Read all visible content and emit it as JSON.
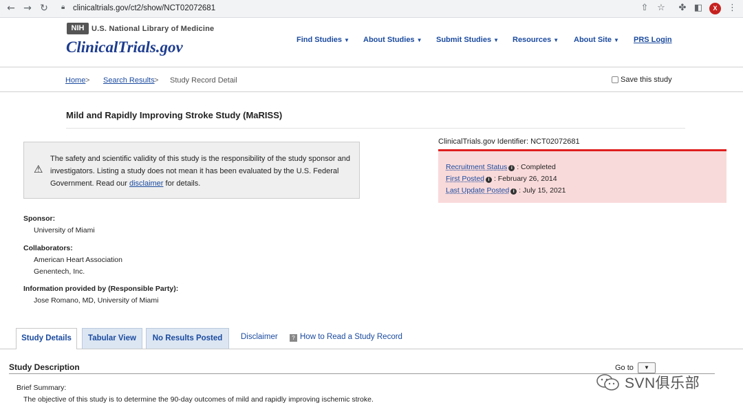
{
  "browser": {
    "url": "clinicaltrials.gov/ct2/show/NCT02072681",
    "avatar_letter": "X"
  },
  "header": {
    "nih_logo": "NIH",
    "nlm_text": "U.S. National Library of Medicine",
    "site_logo": "ClinicalTrials.gov",
    "nav": [
      {
        "label": "Find Studies"
      },
      {
        "label": "About Studies"
      },
      {
        "label": "Submit Studies"
      },
      {
        "label": "Resources"
      },
      {
        "label": "About Site"
      },
      {
        "label": "PRS Login"
      }
    ]
  },
  "breadcrumb": {
    "home": "Home",
    "search_results": "Search Results",
    "current": "Study Record Detail",
    "separator": ">",
    "save_label": "Save this study"
  },
  "study": {
    "title": "Mild and Rapidly Improving Stroke Study (MaRISS)",
    "identifier": "ClinicalTrials.gov Identifier: NCT02072681"
  },
  "disclaimer": {
    "text_before": "The safety and scientific validity of this study is the responsibility of the study sponsor and investigators. Listing a study does not mean it has been evaluated by the U.S. Federal Government. Read our ",
    "link": "disclaimer",
    "text_after": " for details."
  },
  "status": {
    "recruitment_label": "Recruitment Status",
    "recruitment_value": ": Completed",
    "first_posted_label": "First Posted",
    "first_posted_value": ": February 26, 2014",
    "last_update_label": "Last Update Posted",
    "last_update_value": ": July 15, 2021"
  },
  "sponsor": {
    "sponsor_heading": "Sponsor:",
    "sponsor_value": "University of Miami",
    "collaborators_heading": "Collaborators:",
    "collaborators": [
      "American Heart Association",
      "Genentech, Inc."
    ],
    "info_heading": "Information provided by (Responsible Party):",
    "info_value": "Jose Romano, MD, University of Miami"
  },
  "tabs": {
    "study_details": "Study Details",
    "tabular_view": "Tabular View",
    "no_results": "No Results Posted",
    "disclaimer": "Disclaimer",
    "how_to_read": "How to Read a Study Record"
  },
  "description": {
    "section_title": "Study Description",
    "goto_label": "Go to",
    "brief_label": "Brief Summary:",
    "brief_text": "The objective of this study is to determine the 90-day outcomes of mild and rapidly improving ischemic stroke."
  },
  "watermark": {
    "text": "SVN俱乐部"
  }
}
